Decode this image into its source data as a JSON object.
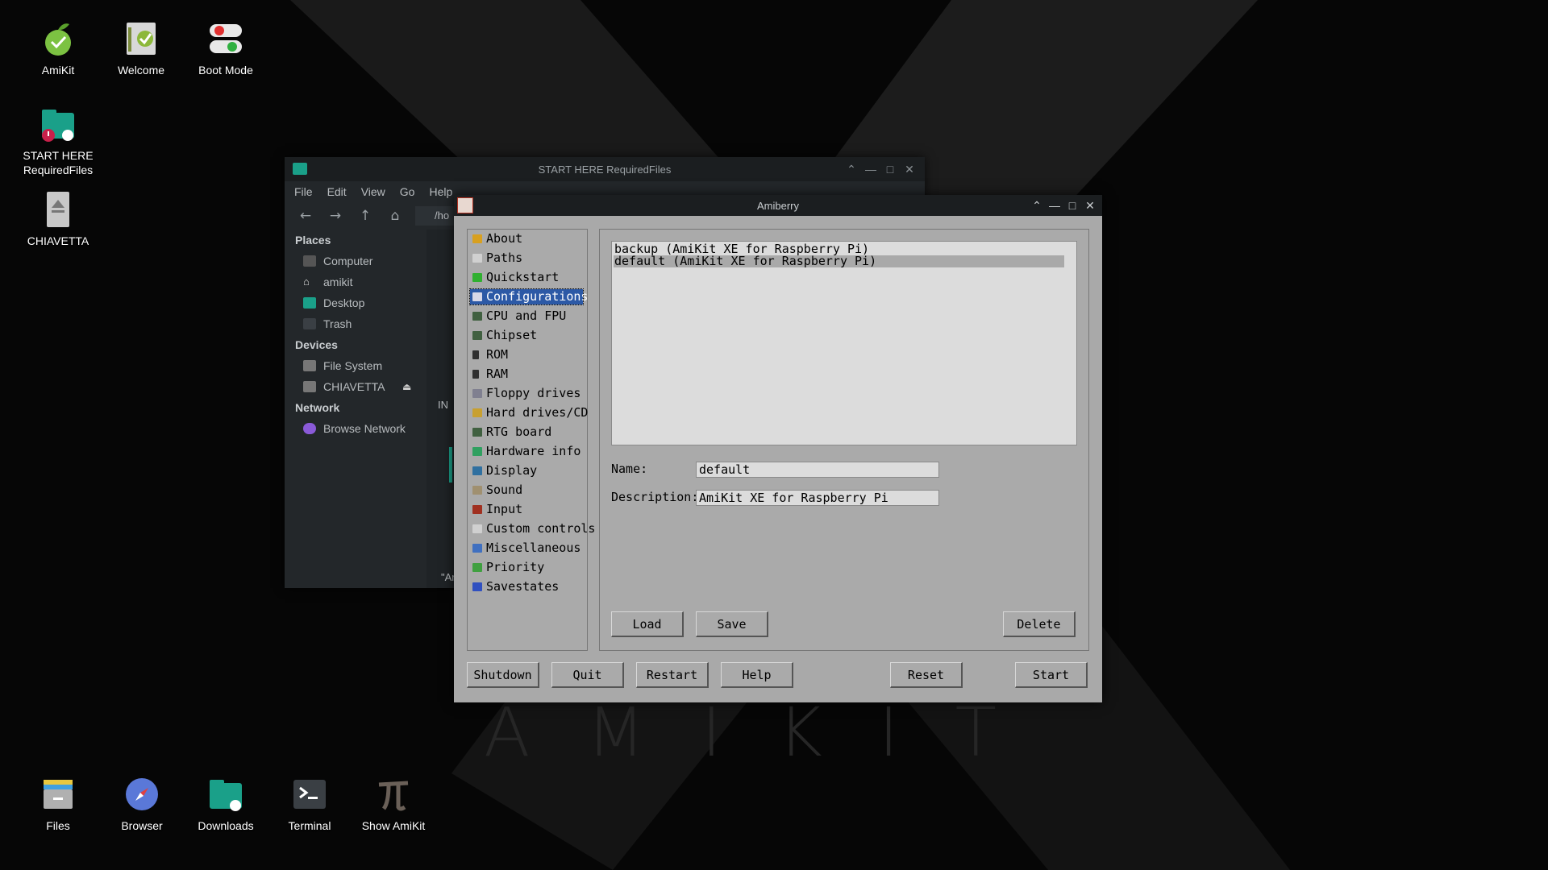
{
  "desktop": {
    "wallpaper_text": "AMIKIT",
    "icons_top": [
      {
        "label": "AmiKit"
      },
      {
        "label": "Welcome"
      },
      {
        "label": "Boot Mode"
      }
    ],
    "icons_side": [
      {
        "label": "START HERE RequiredFiles"
      },
      {
        "label": "CHIAVETTA"
      }
    ],
    "icons_bottom": [
      {
        "label": "Files"
      },
      {
        "label": "Browser"
      },
      {
        "label": "Downloads"
      },
      {
        "label": "Terminal"
      },
      {
        "label": "Show AmiKit"
      }
    ]
  },
  "file_manager": {
    "title": "START HERE RequiredFiles",
    "menu": [
      "File",
      "Edit",
      "View",
      "Go",
      "Help"
    ],
    "path": "/ho",
    "sections": {
      "places": "Places",
      "devices": "Devices",
      "network": "Network"
    },
    "places": [
      "Computer",
      "amikit",
      "Desktop",
      "Trash"
    ],
    "devices": [
      "File System",
      "CHIAVETTA"
    ],
    "network": [
      "Browse Network"
    ],
    "main_partial_text": "IN",
    "status_partial": "\"Ar"
  },
  "amiberry": {
    "title": "Amiberry",
    "nav": [
      "About",
      "Paths",
      "Quickstart",
      "Configurations",
      "CPU and FPU",
      "Chipset",
      "ROM",
      "RAM",
      "Floppy drives",
      "Hard drives/CD",
      "RTG board",
      "Hardware info",
      "Display",
      "Sound",
      "Input",
      "Custom controls",
      "Miscellaneous",
      "Priority",
      "Savestates"
    ],
    "selected_nav": "Configurations",
    "configs": [
      "backup (AmiKit XE for Raspberry Pi)",
      "default (AmiKit XE for Raspberry Pi)"
    ],
    "selected_config": "default (AmiKit XE for Raspberry Pi)",
    "name_label": "Name:",
    "name_value": "default",
    "description_label": "Description:",
    "description_value": "AmiKit XE for Raspberry Pi",
    "buttons": {
      "load": "Load",
      "save": "Save",
      "delete": "Delete",
      "shutdown": "Shutdown",
      "quit": "Quit",
      "restart": "Restart",
      "help": "Help",
      "reset": "Reset",
      "start": "Start"
    }
  }
}
